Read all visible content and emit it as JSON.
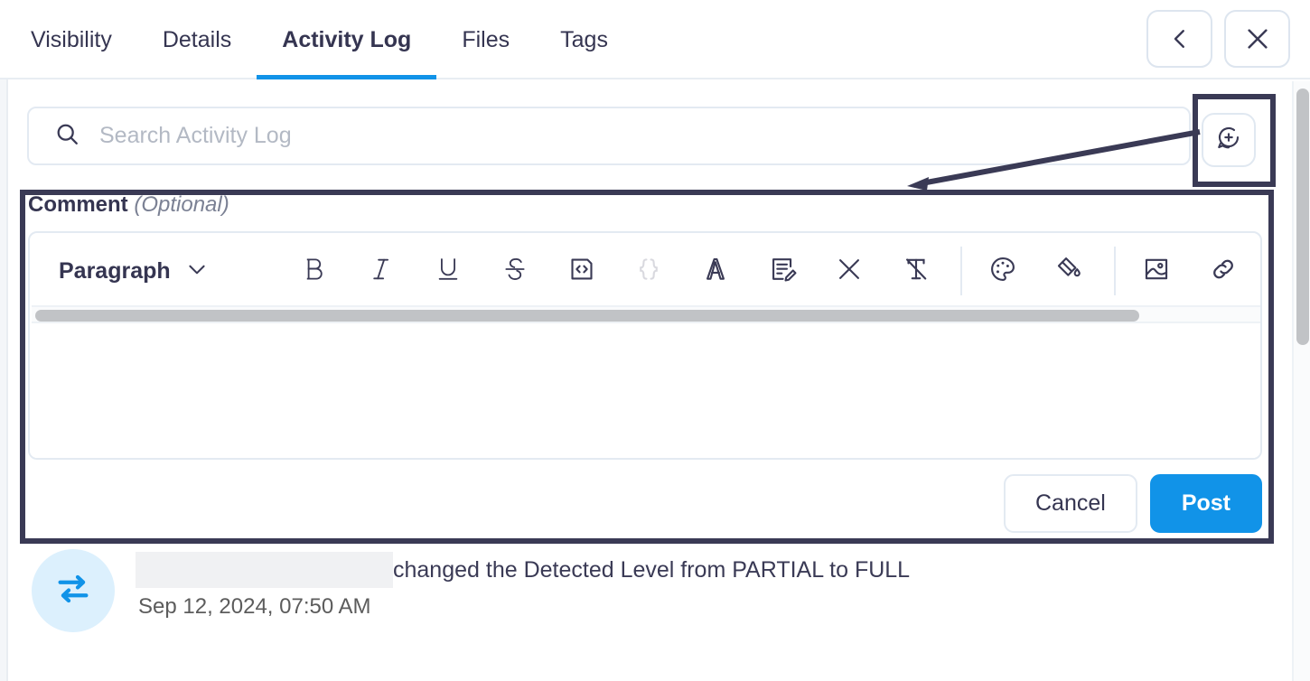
{
  "tabs": [
    {
      "label": "Visibility",
      "active": false
    },
    {
      "label": "Details",
      "active": false
    },
    {
      "label": "Activity Log",
      "active": true
    },
    {
      "label": "Files",
      "active": false
    },
    {
      "label": "Tags",
      "active": false
    }
  ],
  "header": {
    "back_icon": "chevron-left-icon",
    "close_icon": "close-icon"
  },
  "search": {
    "placeholder": "Search Activity Log",
    "value": "",
    "icon": "search-icon"
  },
  "add_comment": {
    "icon": "comment-plus-icon",
    "tooltip": ""
  },
  "comment_panel": {
    "label": "Comment",
    "optional": "(Optional)",
    "editor": {
      "block_style": "Paragraph",
      "chevron": "chevron-down-icon",
      "body_text": "",
      "tools": [
        {
          "name": "bold-icon",
          "label": "B",
          "disabled": false
        },
        {
          "name": "italic-icon",
          "label": "I",
          "disabled": false
        },
        {
          "name": "underline-icon",
          "label": "U",
          "disabled": false
        },
        {
          "name": "strikethrough-icon",
          "label": "S",
          "disabled": false
        },
        {
          "name": "inline-code-icon",
          "label": "<>",
          "disabled": false
        },
        {
          "name": "code-block-icon",
          "label": "{ }",
          "disabled": true
        },
        {
          "name": "font-icon",
          "label": "A",
          "disabled": false
        },
        {
          "name": "edit-document-icon",
          "label": "",
          "disabled": false
        },
        {
          "name": "clear-icon",
          "label": "X",
          "disabled": false
        },
        {
          "name": "clear-formatting-icon",
          "label": "T",
          "disabled": false
        },
        {
          "name": "text-color-palette-icon",
          "label": "",
          "disabled": false
        },
        {
          "name": "highlight-fill-icon",
          "label": "",
          "disabled": false
        },
        {
          "name": "insert-image-icon",
          "label": "",
          "disabled": false
        },
        {
          "name": "insert-link-icon",
          "label": "",
          "disabled": false
        }
      ]
    },
    "cancel_label": "Cancel",
    "post_label": "Post"
  },
  "activity": {
    "entries": [
      {
        "icon": "swap-arrows-icon",
        "author": "",
        "text": "changed the Detected Level from PARTIAL to FULL",
        "timestamp": "Sep 12, 2024, 07:50 AM"
      }
    ]
  },
  "colors": {
    "accent_blue": "#1193e8",
    "text_dark": "#353551",
    "muted": "#7b8194",
    "annotation": "#3a3a55",
    "avatar_bg": "#dcf0fd"
  }
}
